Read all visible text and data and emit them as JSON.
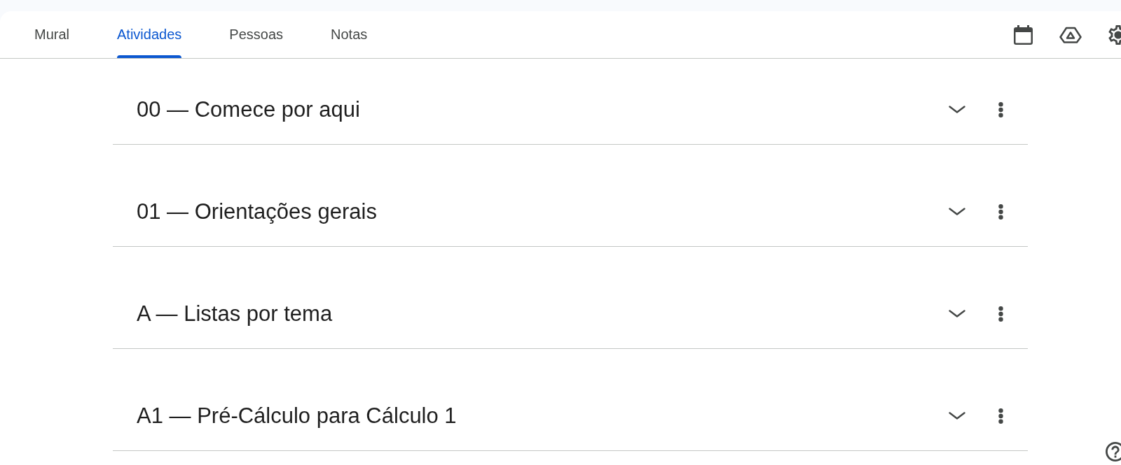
{
  "tabs": [
    {
      "label": "Mural",
      "selected": false
    },
    {
      "label": "Atividades",
      "selected": true
    },
    {
      "label": "Pessoas",
      "selected": false
    },
    {
      "label": "Notas",
      "selected": false
    }
  ],
  "topics": [
    {
      "title": "00 — Comece por aqui",
      "expanded": false
    },
    {
      "title": "01 — Orientações gerais",
      "expanded": false
    },
    {
      "title": "A — Listas por tema",
      "expanded": false
    },
    {
      "title": "A1 — Pré-Cálculo para Cálculo 1",
      "expanded": false
    }
  ]
}
